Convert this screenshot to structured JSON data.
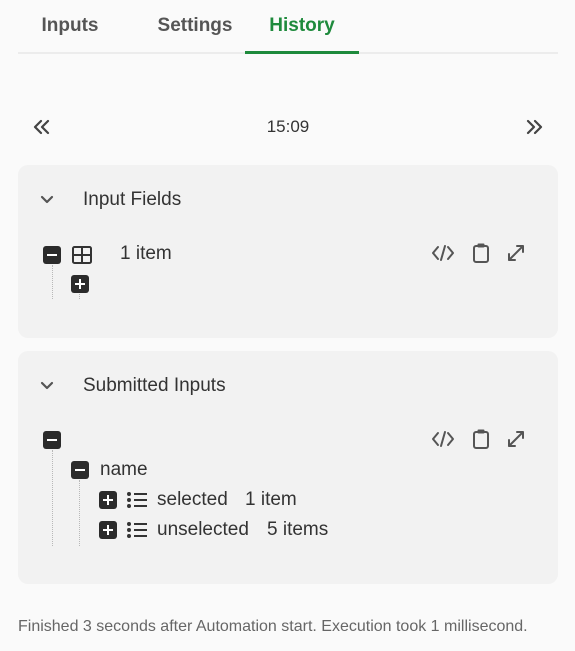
{
  "tabs": [
    {
      "label": "Inputs",
      "active": false
    },
    {
      "label": "Settings",
      "active": false
    },
    {
      "label": "History",
      "active": true
    }
  ],
  "navigation": {
    "time": "15:09",
    "prev_icon": "double-chevron-left-icon",
    "next_icon": "double-chevron-right-icon"
  },
  "input_fields": {
    "title": "Input Fields",
    "tree": {
      "root_state": "expanded",
      "root_icon": "table-icon",
      "root_count": "1 item",
      "child_state": "collapsed"
    },
    "tools": [
      "code-icon",
      "clipboard-icon",
      "expand-icon"
    ]
  },
  "submitted_inputs": {
    "title": "Submitted Inputs",
    "tree": {
      "root_state": "expanded",
      "name_node": {
        "label": "name",
        "state": "expanded"
      },
      "children": [
        {
          "key": "selected",
          "count": "1 item",
          "state": "collapsed",
          "icon": "list-icon"
        },
        {
          "key": "unselected",
          "count": "5 items",
          "state": "collapsed",
          "icon": "list-icon"
        }
      ]
    },
    "tools": [
      "code-icon",
      "clipboard-icon",
      "expand-icon"
    ]
  },
  "footer": {
    "text": "Finished 3 seconds after Automation start. Execution took 1 millisecond."
  },
  "colors": {
    "accent": "#1e8a3c",
    "card_bg": "#f2f2f2",
    "page_bg": "#fafafa"
  }
}
